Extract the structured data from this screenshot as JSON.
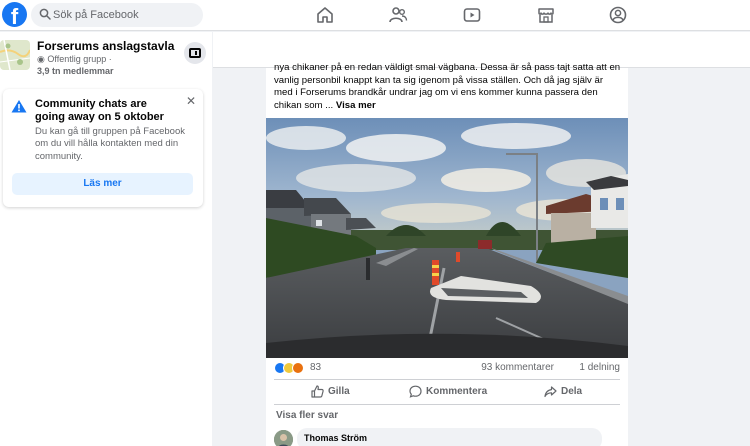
{
  "header": {
    "logo_letter": "f",
    "search_placeholder": "Sök på Facebook",
    "nav_icons": [
      "home-icon",
      "friends-icon",
      "watch-icon",
      "marketplace-icon",
      "profile-icon"
    ]
  },
  "group": {
    "name": "Forserums anslagstavla",
    "type": "Offentlig grupp ·",
    "members": "3,9 tn medlemmar"
  },
  "notice": {
    "title": "Community chats are going away on 5 oktober",
    "body": "Du kan gå till gruppen på Facebook om du vill hålla kontakten med din community.",
    "button": "Läs mer"
  },
  "post": {
    "text": "nya chikaner på en redan väldigt smal vägbana. Dessa är så pass tajt satta att en vanlig personbil knappt kan ta sig igenom på vissa ställen. Och då jag själv är med i Forserums brandkår undrar jag om vi ens kommer kunna passera den chikan som ...",
    "see_more": "Visa mer",
    "reaction_count": "83",
    "comments": "93 kommentarer",
    "shares": "1 delning",
    "actions": {
      "like": "Gilla",
      "comment": "Kommentera",
      "share": "Dela"
    },
    "more_replies": "Visa fler svar",
    "commenter_name": "Thomas Ström"
  },
  "colors": {
    "brand": "#1877f2",
    "warning": "#1877f2",
    "muted": "#65676b"
  }
}
